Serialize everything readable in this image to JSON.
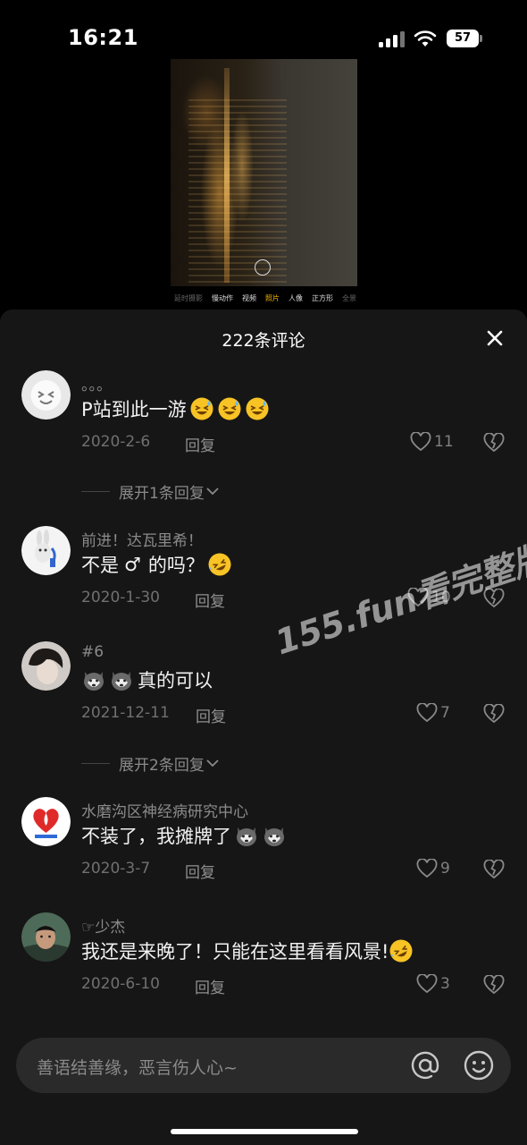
{
  "status_bar": {
    "time": "16:21",
    "battery": "57"
  },
  "video_preview": {
    "camera_modes": [
      "延时摄影",
      "慢动作",
      "视频",
      "照片",
      "人像",
      "正方形",
      "全景"
    ],
    "active_mode": "照片"
  },
  "panel": {
    "title": "222条评论",
    "close_icon": "close-icon"
  },
  "comments": [
    {
      "username": "。。。",
      "text": "P站到此一游",
      "emoji": [
        "laugh-sweat-emoji",
        "laugh-sweat-emoji",
        "laugh-sweat-emoji"
      ],
      "date": "2020-2-6",
      "reply_label": "回复",
      "likes": "11",
      "expand_label": "展开1条回复"
    },
    {
      "username": "前进！达瓦里希！",
      "text_before": "不是",
      "symbol": "♂",
      "text_after": "的吗？",
      "emoji": [
        "rofl-emoji"
      ],
      "date": "2020-1-30",
      "reply_label": "回复",
      "likes": "10"
    },
    {
      "username": "#6",
      "emoji_before": [
        "husky-emoji",
        "husky-emoji"
      ],
      "text": "真的可以",
      "date": "2021-12-11",
      "reply_label": "回复",
      "likes": "7",
      "expand_label": "展开2条回复"
    },
    {
      "username": "水磨沟区神经病研究中心",
      "text": "不装了，我摊牌了",
      "emoji": [
        "husky-emoji",
        "husky-emoji"
      ],
      "date": "2020-3-7",
      "reply_label": "回复",
      "likes": "9"
    },
    {
      "username": "☞少杰",
      "text": "我还是来晚了！只能在这里看看风景!",
      "emoji": [
        "rofl-emoji"
      ],
      "date": "2020-6-10",
      "reply_label": "回复",
      "likes": "3"
    }
  ],
  "watermark": "155.fun看完整版",
  "input": {
    "placeholder": "善语结善缘，恶言伤人心~",
    "icons": [
      "at-icon",
      "emoji-icon"
    ]
  },
  "colors": {
    "panel_bg": "#161616",
    "input_bg": "#2a2a2a",
    "active_mode": "#f5b400"
  }
}
